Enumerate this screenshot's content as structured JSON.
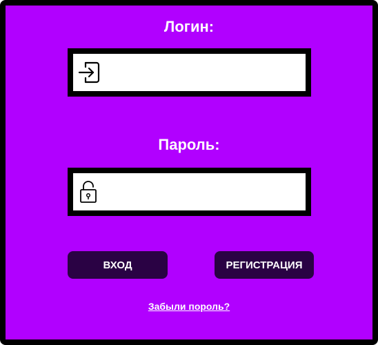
{
  "form": {
    "login_label": "Логин:",
    "password_label": "Пароль:",
    "login_value": "",
    "password_value": "",
    "login_icon": "login-enter-icon",
    "password_icon": "padlock-icon"
  },
  "buttons": {
    "login": "ВХОД",
    "register": "РЕГИСТРАЦИЯ"
  },
  "links": {
    "forgot_password": "Забыли пороль?"
  },
  "colors": {
    "background": "#b100ff",
    "border": "#000000",
    "button": "#2a0244",
    "text": "#ffffff"
  }
}
